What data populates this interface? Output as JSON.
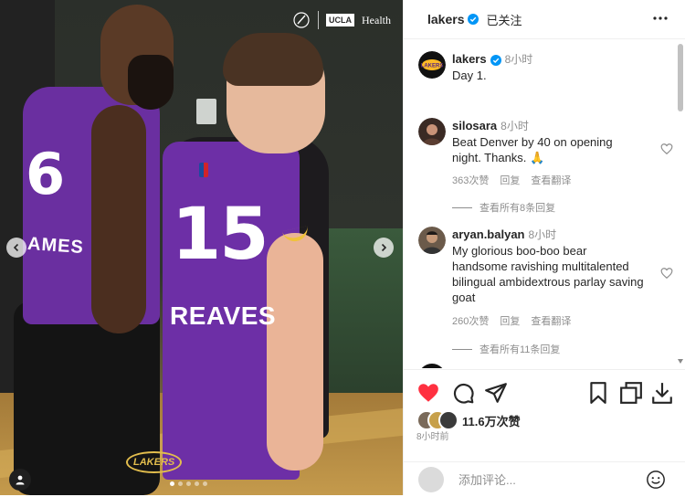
{
  "photo": {
    "brand_right": "Health",
    "brand_box": "UCLA",
    "player1_number": "6",
    "player1_name": "AMES",
    "player2_number": "15",
    "player2_name": "REAVES",
    "floor_logo": "LAKERS",
    "slides": 5,
    "active_slide": 1
  },
  "header": {
    "account": "lakers",
    "follow_status": "已关注"
  },
  "caption": {
    "username": "lakers",
    "time": "8小时",
    "text": "Day 1."
  },
  "comments": [
    {
      "username": "silosara",
      "time": "8小时",
      "text": "Beat Denver by 40 on opening night. Thanks. 🙏",
      "likes": "363次赞",
      "reply": "回复",
      "translate": "查看翻译",
      "view_replies": "查看所有8条回复"
    },
    {
      "username": "aryan.balyan",
      "time": "8小时",
      "text": "My glorious boo-boo bear handsome ravishing multitalented bilingual ambidextrous parlay saving goat",
      "likes": "260次赞",
      "reply": "回复",
      "translate": "查看翻译",
      "view_replies": "查看所有11条回复"
    }
  ],
  "post": {
    "like_count": "11.6万次赞",
    "posted_ago": "8小时前"
  },
  "add_comment": {
    "placeholder": "添加评论..."
  },
  "colors": {
    "like_red": "#ff3040",
    "verified_blue": "#0095f6",
    "lakers_purple": "#6d2fa6",
    "lakers_gold": "#fdb927"
  }
}
